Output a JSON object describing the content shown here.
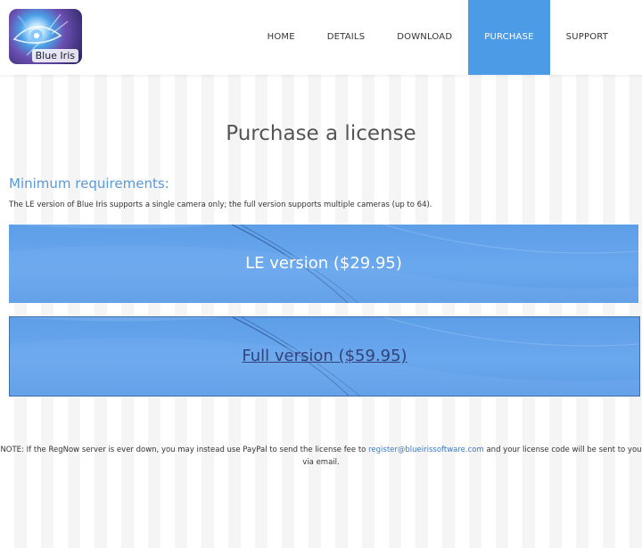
{
  "logo": {
    "text": "Blue Iris"
  },
  "nav": {
    "items": [
      {
        "label": "HOME",
        "active": false
      },
      {
        "label": "DETAILS",
        "active": false
      },
      {
        "label": "DOWNLOAD",
        "active": false
      },
      {
        "label": "PURCHASE",
        "active": true
      },
      {
        "label": "SUPPORT",
        "active": false
      }
    ]
  },
  "page": {
    "title": "Purchase a license",
    "requirements_heading": "Minimum requirements:",
    "requirements_text": "The LE version of Blue Iris supports a single camera only; the full version supports multiple cameras (up to 64)."
  },
  "buttons": {
    "le": "LE version ($29.95)",
    "full": "Full version ($59.95)"
  },
  "note": {
    "prefix": "NOTE: If the RegNow server is ever down, you may instead use PayPal to send the license fee to",
    "email": "register@blueirissoftware.com",
    "suffix": "and your license code will be sent to you via email."
  },
  "colors": {
    "accent": "#4b9be6",
    "heading": "#5a9ad6",
    "button_blue": "#6aa8ee"
  }
}
